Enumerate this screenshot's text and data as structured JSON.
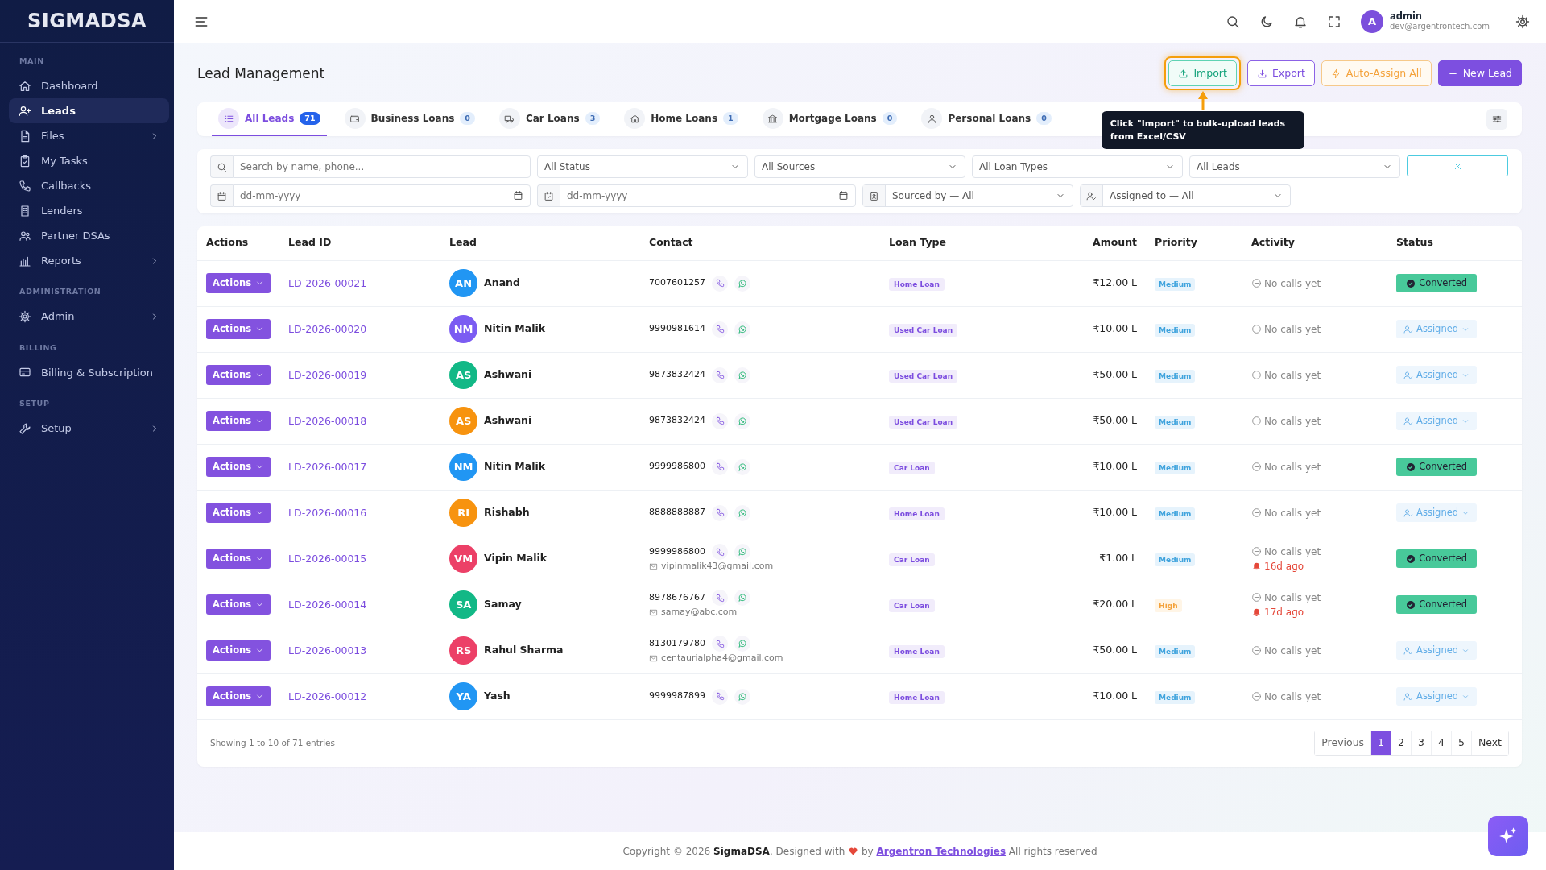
{
  "sidebar": {
    "logo": "SIGMADSA",
    "sections": [
      {
        "title": "MAIN",
        "items": [
          {
            "label": "Dashboard",
            "selected": false,
            "expandable": false
          },
          {
            "label": "Leads",
            "selected": true,
            "expandable": false
          },
          {
            "label": "Files",
            "selected": false,
            "expandable": true
          },
          {
            "label": "My Tasks",
            "selected": false,
            "expandable": false
          },
          {
            "label": "Callbacks",
            "selected": false,
            "expandable": false
          },
          {
            "label": "Lenders",
            "selected": false,
            "expandable": false
          },
          {
            "label": "Partner DSAs",
            "selected": false,
            "expandable": false
          },
          {
            "label": "Reports",
            "selected": false,
            "expandable": true
          }
        ]
      },
      {
        "title": "ADMINISTRATION",
        "items": [
          {
            "label": "Admin",
            "selected": false,
            "expandable": true
          }
        ]
      },
      {
        "title": "BILLING",
        "items": [
          {
            "label": "Billing & Subscription",
            "selected": false,
            "expandable": false
          }
        ]
      },
      {
        "title": "SETUP",
        "items": [
          {
            "label": "Setup",
            "selected": false,
            "expandable": true
          }
        ]
      }
    ]
  },
  "header": {
    "avatar": "A",
    "user_name": "admin",
    "user_email": "dev@argentrontech.com"
  },
  "page_title": "Lead Management",
  "actions": [
    {
      "label": "Import",
      "kind": "import",
      "highlighted": true
    },
    {
      "label": "Export",
      "kind": "export",
      "highlighted": false
    },
    {
      "label": "Auto-Assign All",
      "kind": "auto",
      "highlighted": false
    },
    {
      "label": "New Lead",
      "kind": "new",
      "highlighted": false
    }
  ],
  "tooltip": "Click \"Import\" to bulk-upload leads from Excel/CSV",
  "tabs": [
    {
      "label": "All Leads",
      "count": "71",
      "selected": true
    },
    {
      "label": "Business Loans",
      "count": "0",
      "selected": false
    },
    {
      "label": "Car Loans",
      "count": "3",
      "selected": false
    },
    {
      "label": "Home Loans",
      "count": "1",
      "selected": false
    },
    {
      "label": "Mortgage Loans",
      "count": "0",
      "selected": false
    },
    {
      "label": "Personal Loans",
      "count": "0",
      "selected": false
    }
  ],
  "filters": {
    "search": {
      "placeholder": "Search by name, phone..."
    },
    "selects": [
      "All Status",
      "All Sources",
      "All Loan Types",
      "All Leads"
    ],
    "dates": [
      {
        "placeholder": "dd-mm-yyyy"
      },
      {
        "placeholder": "dd-mm-yyyy"
      }
    ],
    "sourced_by": "Sourced by — All",
    "assigned_to": "Assigned to — All"
  },
  "table": {
    "columns": [
      "Actions",
      "Lead ID",
      "Lead",
      "Contact",
      "Loan Type",
      "Amount",
      "Priority",
      "Activity",
      "Status"
    ],
    "rows": [
      {
        "action": "Actions",
        "lead_id": "LD-2026-00021",
        "initials": "AN",
        "name": "Anand",
        "color": "#2196f3",
        "phone": "7007601257",
        "loan_type": "Home Loan",
        "amount": "₹12.00 L",
        "priority": "Medium",
        "high_priority": false,
        "activity": "No calls yet",
        "status": "Converted",
        "converted": true
      },
      {
        "action": "Actions",
        "lead_id": "LD-2026-00020",
        "initials": "NM",
        "name": "Nitin Malik",
        "color": "#7b5cf2",
        "phone": "9990981614",
        "loan_type": "Used Car Loan",
        "amount": "₹10.00 L",
        "priority": "Medium",
        "high_priority": false,
        "activity": "No calls yet",
        "status": "Assigned",
        "converted": false
      },
      {
        "action": "Actions",
        "lead_id": "LD-2026-00019",
        "initials": "AS",
        "name": "Ashwani",
        "color": "#12b886",
        "phone": "9873832424",
        "loan_type": "Used Car Loan",
        "amount": "₹50.00 L",
        "priority": "Medium",
        "high_priority": false,
        "activity": "No calls yet",
        "status": "Assigned",
        "converted": false
      },
      {
        "action": "Actions",
        "lead_id": "LD-2026-00018",
        "initials": "AS",
        "name": "Ashwani",
        "color": "#f7930f",
        "phone": "9873832424",
        "loan_type": "Used Car Loan",
        "amount": "₹50.00 L",
        "priority": "Medium",
        "high_priority": false,
        "activity": "No calls yet",
        "status": "Assigned",
        "converted": false
      },
      {
        "action": "Actions",
        "lead_id": "LD-2026-00017",
        "initials": "NM",
        "name": "Nitin Malik",
        "color": "#2196f3",
        "phone": "9999986800",
        "loan_type": "Car Loan",
        "amount": "₹10.00 L",
        "priority": "Medium",
        "high_priority": false,
        "activity": "No calls yet",
        "status": "Converted",
        "converted": true
      },
      {
        "action": "Actions",
        "lead_id": "LD-2026-00016",
        "initials": "RI",
        "name": "Rishabh",
        "color": "#f7930f",
        "phone": "8888888887",
        "loan_type": "Home Loan",
        "amount": "₹10.00 L",
        "priority": "Medium",
        "high_priority": false,
        "activity": "No calls yet",
        "status": "Assigned",
        "converted": false
      },
      {
        "action": "Actions",
        "lead_id": "LD-2026-00015",
        "initials": "VM",
        "name": "Vipin Malik",
        "color": "#ec4067",
        "phone": "9999986800",
        "email": "vipinmalik43@gmail.com",
        "loan_type": "Car Loan",
        "amount": "₹1.00 L",
        "priority": "Medium",
        "high_priority": false,
        "activity": "No calls yet",
        "reminder": "16d ago",
        "status": "Converted",
        "converted": true
      },
      {
        "action": "Actions",
        "lead_id": "LD-2026-00014",
        "initials": "SA",
        "name": "Samay",
        "color": "#12b886",
        "phone": "8978676767",
        "email": "samay@abc.com",
        "loan_type": "Car Loan",
        "amount": "₹20.00 L",
        "priority": "High",
        "high_priority": true,
        "activity": "No calls yet",
        "reminder": "17d ago",
        "status": "Converted",
        "converted": true
      },
      {
        "action": "Actions",
        "lead_id": "LD-2026-00013",
        "initials": "RS",
        "name": "Rahul Sharma",
        "color": "#ec4067",
        "phone": "8130179780",
        "email": "centaurialpha4@gmail.com",
        "loan_type": "Home Loan",
        "amount": "₹50.00 L",
        "priority": "Medium",
        "high_priority": false,
        "activity": "No calls yet",
        "status": "Assigned",
        "converted": false
      },
      {
        "action": "Actions",
        "lead_id": "LD-2026-00012",
        "initials": "YA",
        "name": "Yash",
        "color": "#2196f3",
        "phone": "9999987899",
        "loan_type": "Home Loan",
        "amount": "₹10.00 L",
        "priority": "Medium",
        "high_priority": false,
        "activity": "No calls yet",
        "status": "Assigned",
        "converted": false
      }
    ]
  },
  "pagination": {
    "summary": "Showing 1 to 10 of 71 entries",
    "previous": "Previous",
    "next": "Next",
    "pages": [
      {
        "label": "1",
        "selected": true
      },
      {
        "label": "2",
        "selected": false
      },
      {
        "label": "3",
        "selected": false
      },
      {
        "label": "4",
        "selected": false
      },
      {
        "label": "5",
        "selected": false
      }
    ]
  },
  "footer": {
    "text_before": "Copyright © 2026 **SigmaDSA**. Designed with",
    "text_middle": "by",
    "link": "Argentron Technologies",
    "text_after": "All rights reserved"
  }
}
